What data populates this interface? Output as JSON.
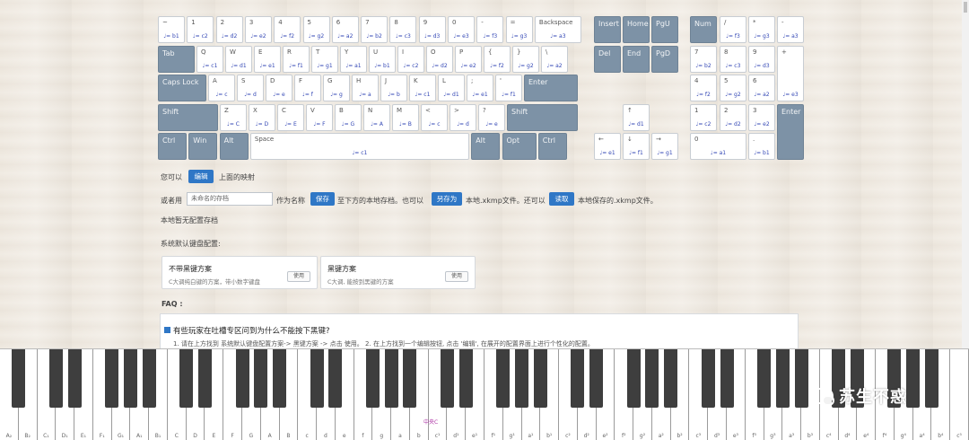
{
  "keyboard": {
    "main": [
      [
        [
          "~",
          "♩= b1"
        ],
        [
          "1",
          "♩= c2"
        ],
        [
          "2",
          "♩= d2"
        ],
        [
          "3",
          "♩= e2"
        ],
        [
          "4",
          "♩= f2"
        ],
        [
          "5",
          "♩= g2"
        ],
        [
          "6",
          "♩= a2"
        ],
        [
          "7",
          "♩= b2"
        ],
        [
          "8",
          "♩= c3"
        ],
        [
          "9",
          "♩= d3"
        ],
        [
          "0",
          "♩= e3"
        ],
        [
          "-",
          "♩= f3"
        ],
        [
          "=",
          "♩= g3"
        ],
        [
          "Backspace",
          "♩= a3"
        ]
      ],
      [
        [
          "Tab",
          ""
        ],
        [
          "Q",
          "♩= c1"
        ],
        [
          "W",
          "♩= d1"
        ],
        [
          "E",
          "♩= e1"
        ],
        [
          "R",
          "♩= f1"
        ],
        [
          "T",
          "♩= g1"
        ],
        [
          "Y",
          "♩= a1"
        ],
        [
          "U",
          "♩= b1"
        ],
        [
          "I",
          "♩= c2"
        ],
        [
          "O",
          "♩= d2"
        ],
        [
          "P",
          "♩= e2"
        ],
        [
          "{",
          "♩= f2"
        ],
        [
          "}",
          "♩= g2"
        ],
        [
          "\\",
          "♩= a2"
        ]
      ],
      [
        [
          "Caps Lock",
          ""
        ],
        [
          "A",
          "♩= c"
        ],
        [
          "S",
          "♩= d"
        ],
        [
          "D",
          "♩= e"
        ],
        [
          "F",
          "♩= f"
        ],
        [
          "G",
          "♩= g"
        ],
        [
          "H",
          "♩= a"
        ],
        [
          "J",
          "♩= b"
        ],
        [
          "K",
          "♩= c1"
        ],
        [
          "L",
          "♩= d1"
        ],
        [
          ";",
          "♩= e1"
        ],
        [
          "'",
          "♩= f1"
        ],
        [
          "Enter",
          ""
        ]
      ],
      [
        [
          "Shift",
          ""
        ],
        [
          "Z",
          "♩= C"
        ],
        [
          "X",
          "♩= D"
        ],
        [
          "C",
          "♩= E"
        ],
        [
          "V",
          "♩= F"
        ],
        [
          "B",
          "♩= G"
        ],
        [
          "N",
          "♩= A"
        ],
        [
          "M",
          "♩= B"
        ],
        [
          "<",
          "♩= c"
        ],
        [
          ">",
          "♩= d"
        ],
        [
          "?",
          "♩= e"
        ],
        [
          "Shift",
          ""
        ]
      ],
      [
        [
          "Ctrl",
          ""
        ],
        [
          "Win",
          ""
        ],
        [
          "Alt",
          ""
        ],
        [
          "Space",
          "♩= c1"
        ],
        [
          "Alt",
          ""
        ],
        [
          "Opt",
          ""
        ],
        [
          "Ctrl",
          ""
        ]
      ]
    ],
    "nav": [
      [
        "Insert",
        ""
      ],
      [
        "Home",
        ""
      ],
      [
        "PgU",
        ""
      ],
      [
        "Del",
        ""
      ],
      [
        "End",
        ""
      ],
      [
        "PgD",
        ""
      ]
    ],
    "arrows": [
      [
        "↑",
        "♩= d1"
      ],
      [
        "←",
        "♩= e1"
      ],
      [
        "↓",
        "♩= f1"
      ],
      [
        "→",
        "♩= g1"
      ]
    ],
    "numpad": [
      [
        "Num",
        ""
      ],
      [
        "/",
        "♩= f3"
      ],
      [
        "*",
        "♩= g3"
      ],
      [
        "-",
        "♩= a3"
      ],
      [
        "7",
        "♩= b2"
      ],
      [
        "8",
        "♩= c3"
      ],
      [
        "9",
        "♩= d3"
      ],
      [
        "+",
        "♩= e3"
      ],
      [
        "4",
        "♩= f2"
      ],
      [
        "5",
        "♩= g2"
      ],
      [
        "6",
        "♩= a2"
      ],
      [
        "1",
        "♩= c2"
      ],
      [
        "2",
        "♩= d2"
      ],
      [
        "3",
        "♩= e2"
      ],
      [
        "Enter",
        ""
      ],
      [
        "0",
        "♩= a1"
      ],
      [
        ".",
        "♩= b1"
      ]
    ]
  },
  "controls": {
    "line1_pre": "您可以",
    "edit_btn": "编辑",
    "line1_post": "上面的映射",
    "line2_pre": "或者用",
    "name_placeholder": "未命名的存档",
    "as_name": "作为名称",
    "save_btn": "保存",
    "save_desc": "至下方的本地存档。也可以",
    "saveas_btn": "另存为",
    "saveas_desc": "本地.xkmp文件。还可以",
    "read_btn": "读取",
    "read_desc": "本地保存的.xkmp文件。",
    "no_saves": "本地暂无配置存档",
    "defaults_title": "系统默认键盘配置:"
  },
  "presets": [
    {
      "title": "不带黑键方案",
      "desc": "C大调纯白键的方案，带小数字键盘",
      "use": "使用"
    },
    {
      "title": "黑键方案",
      "desc": "C大调, 能按到黑键的方案",
      "use": "使用"
    }
  ],
  "faq": {
    "label": "FAQ :",
    "q1": "有些玩家在吐槽专区问到为什么不能按下黑键?",
    "a1": "1. 请在上方找到 系统默认键盘配置方案-> 黑键方案 -> 点击 使用。 2. 在上方找到一个编辑按钮, 点击 '编辑', 在展开的配置界面上进行个性化的配置。"
  },
  "piano": {
    "labels": [
      "A₂",
      "B₂",
      "C₁",
      "D₁",
      "E₁",
      "F₁",
      "G₁",
      "A₁",
      "B₁",
      "C",
      "D",
      "E",
      "F",
      "G",
      "A",
      "B",
      "c",
      "d",
      "e",
      "f",
      "g",
      "a",
      "b",
      "c¹",
      "d¹",
      "e¹",
      "f¹",
      "g¹",
      "a¹",
      "b¹",
      "c²",
      "d²",
      "e²",
      "f²",
      "g²",
      "a²",
      "b²",
      "c³",
      "d³",
      "e³",
      "f³",
      "g³",
      "a³",
      "b³",
      "c⁴",
      "d⁴",
      "e⁴",
      "f⁴",
      "g⁴",
      "a⁴",
      "b⁴",
      "c⁵"
    ],
    "middle_c": "中央C"
  },
  "watermark": "苏生不惑",
  "colors": {
    "accent": "#2f77c6",
    "modkey": "#7d92a6",
    "note": "#3347b5"
  }
}
